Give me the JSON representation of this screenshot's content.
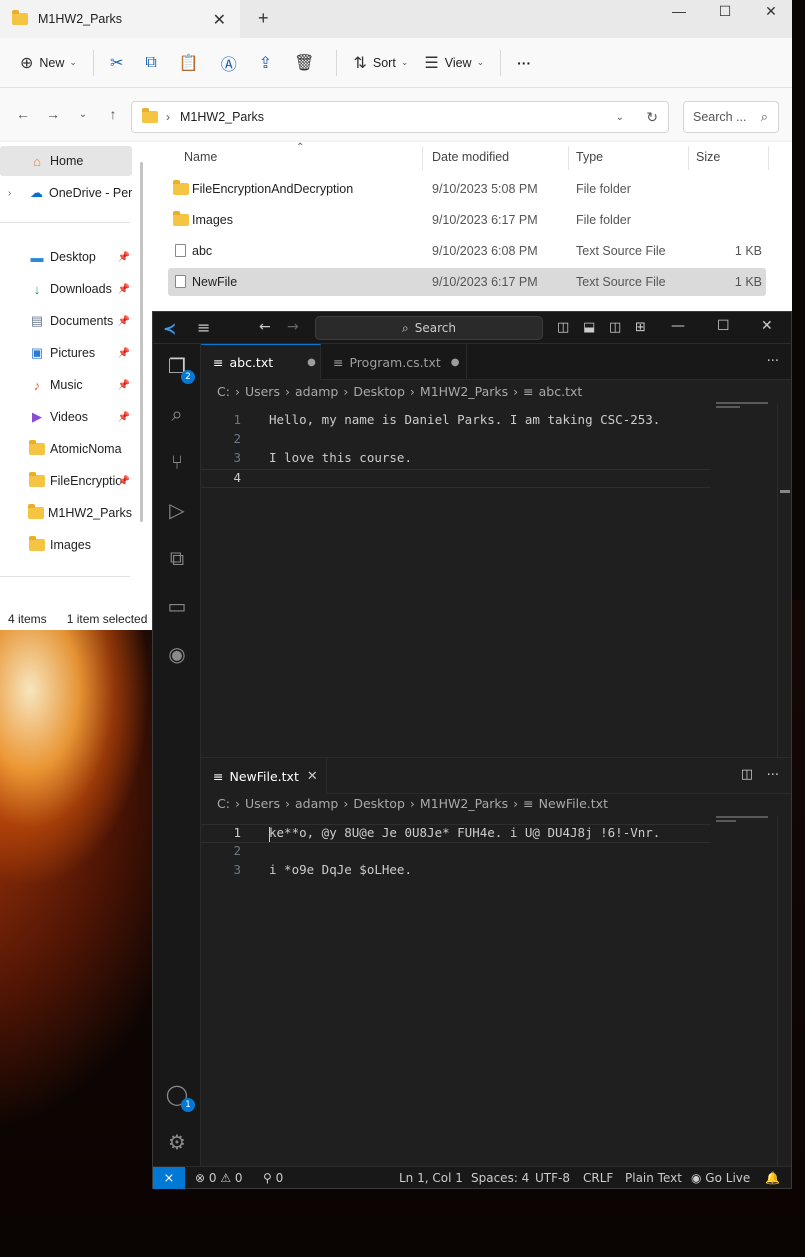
{
  "explorer": {
    "tab_title": "M1HW2_Parks",
    "window_controls": [
      "—",
      "☐",
      "✕"
    ],
    "toolbar": {
      "new_label": "New",
      "sort_label": "Sort",
      "view_label": "View",
      "more_label": "···"
    },
    "address": {
      "crumb": "M1HW2_Parks",
      "search_placeholder": "Search ..."
    },
    "nav": {
      "home": "Home",
      "onedrive": "OneDrive - Perso",
      "items": [
        "Desktop",
        "Downloads",
        "Documents",
        "Pictures",
        "Music",
        "Videos",
        "AtomicNoma",
        "FileEncryptio",
        "M1HW2_Parks",
        "Images"
      ]
    },
    "columns": {
      "name": "Name",
      "date": "Date modified",
      "type": "Type",
      "size": "Size"
    },
    "files": [
      {
        "name": "FileEncryptionAndDecryption",
        "date": "9/10/2023 5:08 PM",
        "type": "File folder",
        "size": "",
        "icon": "folder"
      },
      {
        "name": "Images",
        "date": "9/10/2023 6:17 PM",
        "type": "File folder",
        "size": "",
        "icon": "folder"
      },
      {
        "name": "abc",
        "date": "9/10/2023 6:08 PM",
        "type": "Text Source File",
        "size": "1 KB",
        "icon": "text-file"
      },
      {
        "name": "NewFile",
        "date": "9/10/2023 6:17 PM",
        "type": "Text Source File",
        "size": "1 KB",
        "icon": "text-file"
      }
    ],
    "status": {
      "items": "4 items",
      "selected": "1 item selected"
    }
  },
  "vscode": {
    "search_label": "Search",
    "explorer_badge": "2",
    "accounts_badge": "1",
    "top_editor": {
      "tabs": [
        {
          "label": "abc.txt",
          "dirty": "●"
        },
        {
          "label": "Program.cs.txt",
          "dirty": "●"
        }
      ],
      "breadcrumbs": [
        "C:",
        "Users",
        "adamp",
        "Desktop",
        "M1HW2_Parks",
        "abc.txt"
      ],
      "lines": [
        {
          "n": "1",
          "text": "Hello, my name is Daniel Parks. I am taking CSC-253."
        },
        {
          "n": "2",
          "text": ""
        },
        {
          "n": "3",
          "text": "I love this course."
        },
        {
          "n": "4",
          "text": ""
        }
      ]
    },
    "bottom_editor": {
      "tab": "NewFile.txt",
      "breadcrumbs": [
        "C:",
        "Users",
        "adamp",
        "Desktop",
        "M1HW2_Parks",
        "NewFile.txt"
      ],
      "lines": [
        {
          "n": "1",
          "text": "ke**o, @y 8U@e Je 0U8Je* FUH4e. i U@ DU4J8j !6!-Vnr."
        },
        {
          "n": "2",
          "text": ""
        },
        {
          "n": "3",
          "text": "i *o9e DqJe $oLHee."
        }
      ]
    },
    "status": {
      "problems": "⊗ 0 ⚠ 0",
      "ports": "0",
      "position": "Ln 1, Col 1",
      "spaces": "Spaces: 4",
      "encoding": "UTF-8",
      "eol": "CRLF",
      "language": "Plain Text",
      "golive": "Go Live"
    }
  }
}
